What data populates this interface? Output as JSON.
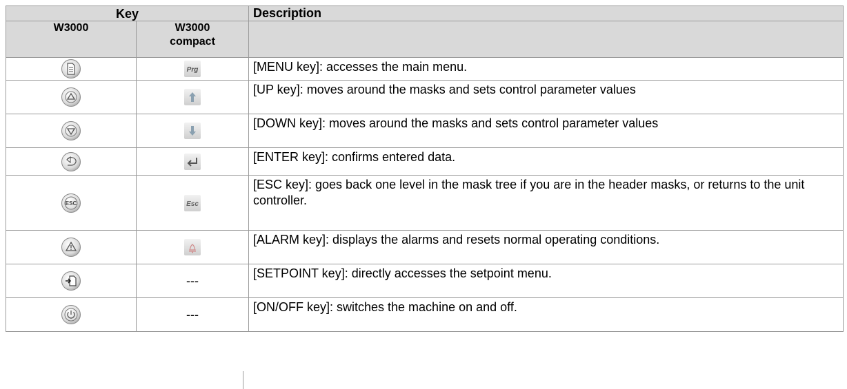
{
  "header": {
    "key": "Key",
    "description": "Description",
    "w3000": "W3000",
    "w3000_compact_line1": "W3000",
    "w3000_compact_line2": "compact"
  },
  "rows": [
    {
      "w3000_icon": "menu-document-icon",
      "compact_icon": "prg-icon",
      "compact_text": "Prg",
      "compact_dash": "",
      "description": "[MENU key]: accesses the main menu."
    },
    {
      "w3000_icon": "up-triangle-icon",
      "compact_icon": "up-arrow-icon",
      "compact_text": "",
      "compact_dash": "",
      "description": "[UP key]: moves around the masks and sets control parameter values"
    },
    {
      "w3000_icon": "down-triangle-icon",
      "compact_icon": "down-arrow-icon",
      "compact_text": "",
      "compact_dash": "",
      "description": "[DOWN key]: moves around the masks and sets control parameter values"
    },
    {
      "w3000_icon": "enter-arrow-icon",
      "compact_icon": "enter-return-icon",
      "compact_text": "",
      "compact_dash": "",
      "description": "[ENTER key]: confirms entered data."
    },
    {
      "w3000_icon": "esc-icon",
      "compact_icon": "esc-text-icon",
      "compact_text": "Esc",
      "compact_dash": "",
      "description": "[ESC key]: goes back one level in the mask tree if you are in the header masks, or returns to the unit controller."
    },
    {
      "w3000_icon": "alarm-triangle-icon",
      "compact_icon": "alarm-bell-icon",
      "compact_text": "",
      "compact_dash": "",
      "description": "[ALARM key]: displays the alarms and resets normal operating conditions."
    },
    {
      "w3000_icon": "setpoint-icon",
      "compact_icon": "",
      "compact_text": "",
      "compact_dash": "---",
      "description": "[SETPOINT key]: directly accesses the setpoint menu."
    },
    {
      "w3000_icon": "power-icon",
      "compact_icon": "",
      "compact_text": "",
      "compact_dash": "---",
      "description": "[ON/OFF key]: switches the machine on and off."
    }
  ]
}
